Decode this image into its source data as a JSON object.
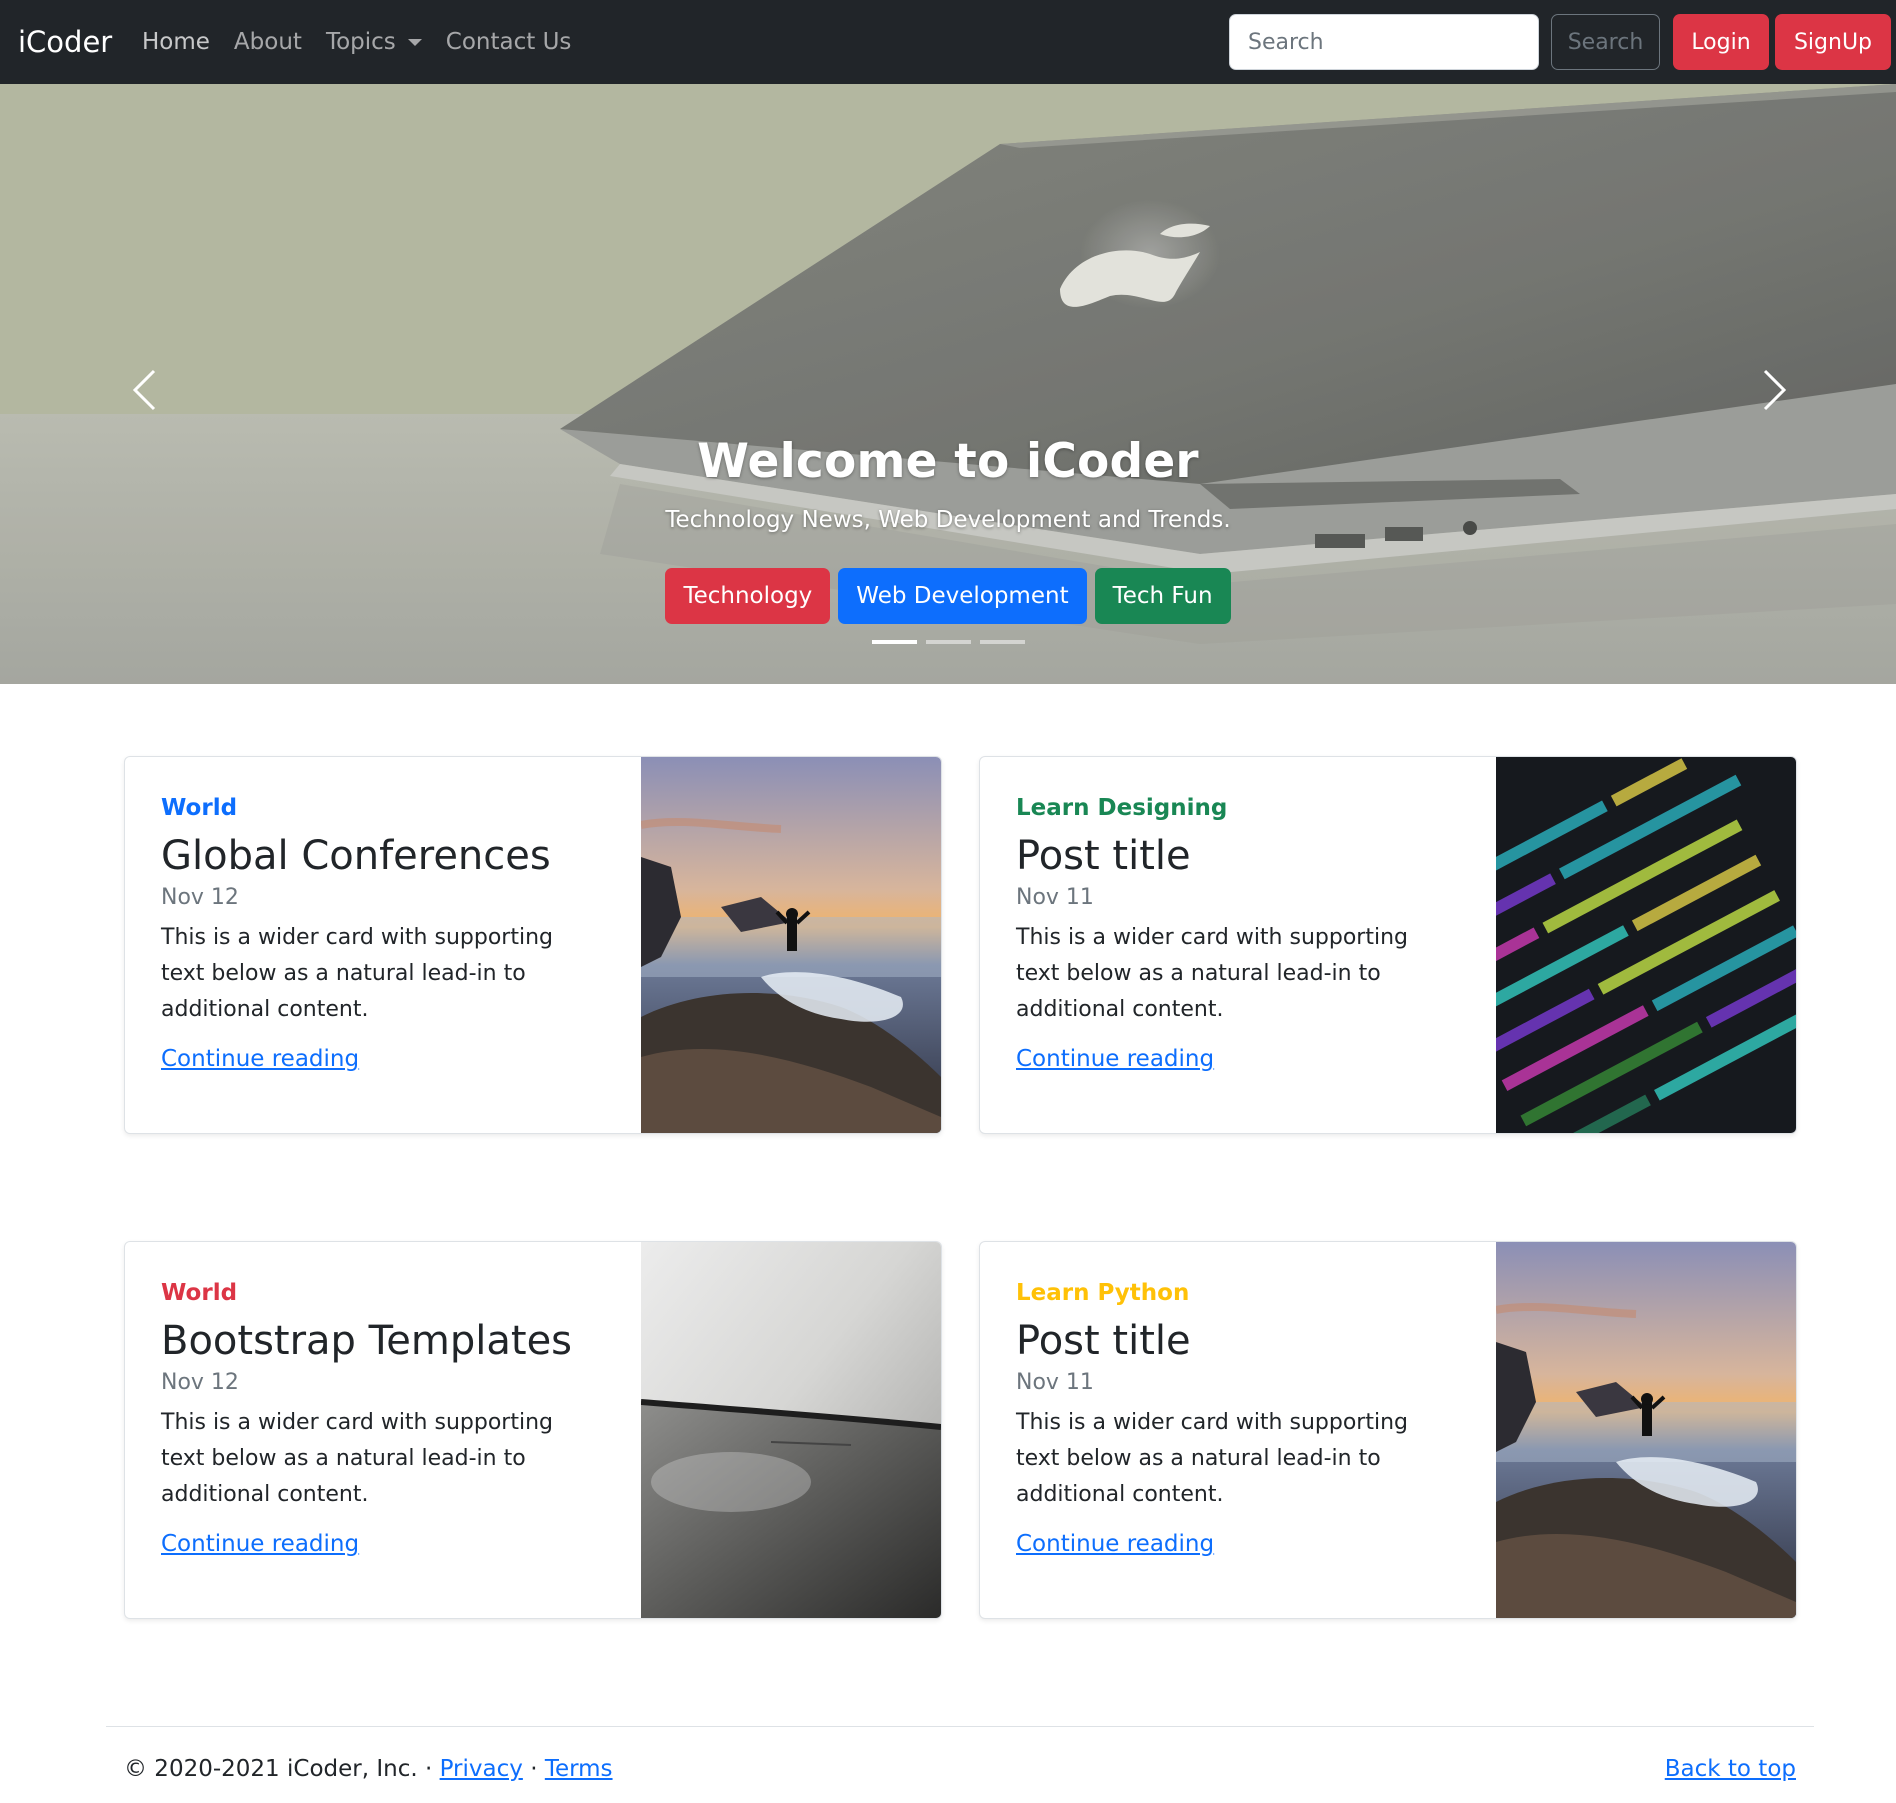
{
  "navbar": {
    "brand": "iCoder",
    "links": [
      {
        "label": "Home"
      },
      {
        "label": "About"
      },
      {
        "label": "Topics"
      },
      {
        "label": "Contact Us"
      }
    ],
    "search_placeholder": "Search",
    "search_button": "Search",
    "login": "Login",
    "signup": "SignUp"
  },
  "hero": {
    "title": "Welcome to iCoder",
    "subtitle": "Technology News, Web Development and Trends.",
    "buttons": [
      {
        "label": "Technology",
        "color": "#dc3545"
      },
      {
        "label": "Web Development",
        "color": "#0d6efd"
      },
      {
        "label": "Tech Fun",
        "color": "#198754"
      }
    ],
    "slide_count": 3,
    "active_slide": 1
  },
  "cards": [
    {
      "category": "World",
      "category_color": "#0d6efd",
      "title": "Global Conferences",
      "date": "Nov 12",
      "text": "This is a wider card with supporting text below as a natural lead-in to additional content.",
      "link": "Continue reading",
      "image": "seaside-rocks-photo"
    },
    {
      "category": "Learn Designing",
      "category_color": "#198754",
      "title": "Post title",
      "date": "Nov 11",
      "text": "This is a wider card with supporting text below as a natural lead-in to additional content.",
      "link": "Continue reading",
      "image": "code-screen-photo"
    },
    {
      "category": "World",
      "category_color": "#dc3545",
      "title": "Bootstrap Templates",
      "date": "Nov 12",
      "text": "This is a wider card with supporting text below as a natural lead-in to additional content.",
      "link": "Continue reading",
      "image": "phone-closeup-photo"
    },
    {
      "category": "Learn Python",
      "category_color": "#ffc107",
      "title": "Post title",
      "date": "Nov 11",
      "text": "This is a wider card with supporting text below as a natural lead-in to additional content.",
      "link": "Continue reading",
      "image": "seaside-rocks-photo"
    }
  ],
  "footer": {
    "copyright": "© 2020-2021 iCoder, Inc. ·",
    "privacy": "Privacy",
    "separator": "·",
    "terms": "Terms",
    "back_to_top": "Back to top"
  }
}
